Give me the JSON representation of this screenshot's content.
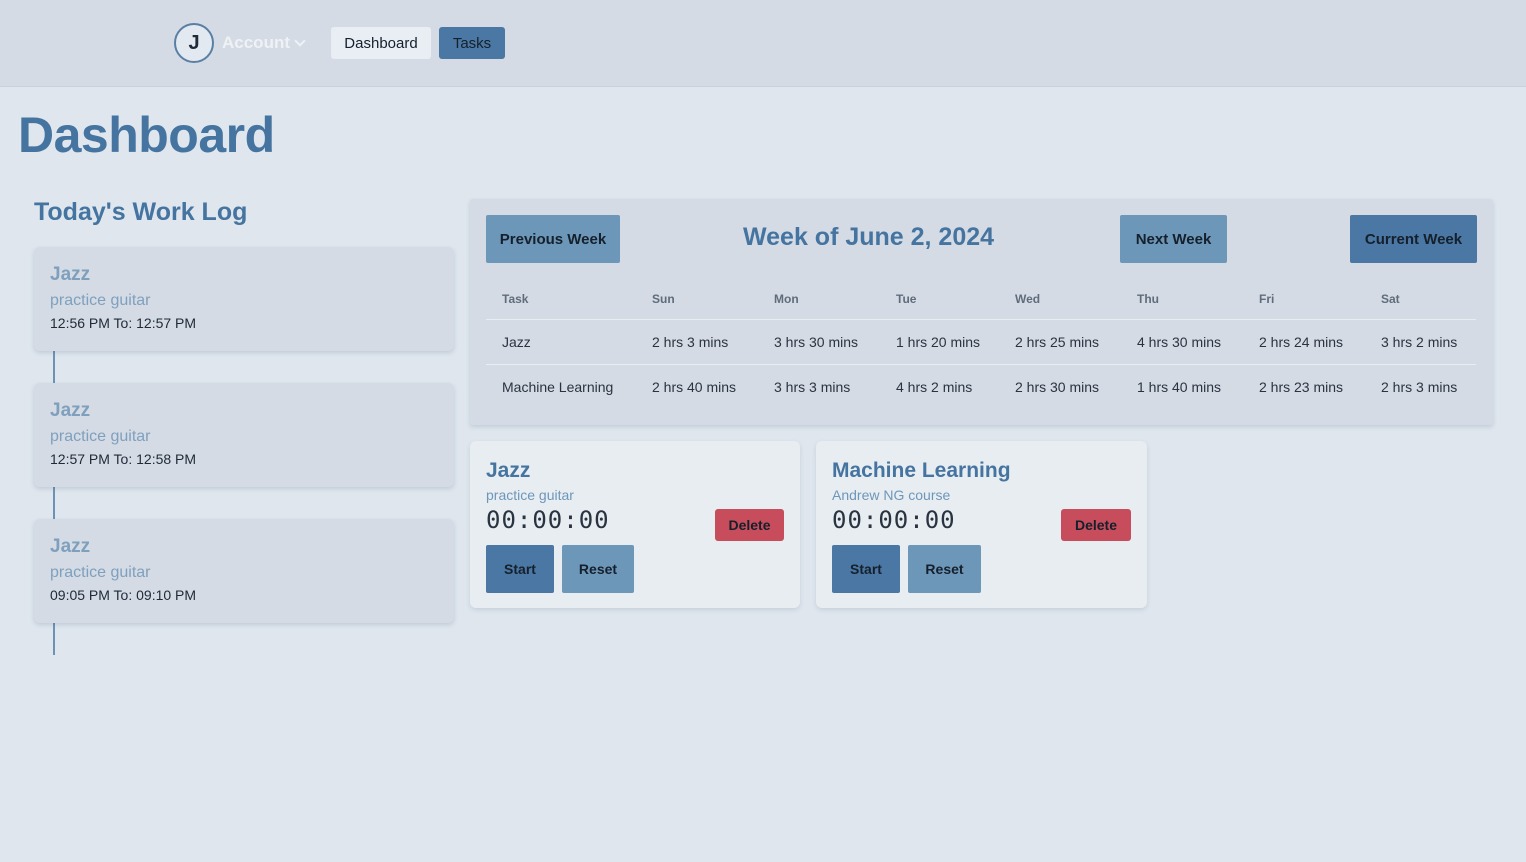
{
  "header": {
    "avatar_initial": "J",
    "account_label": "Account",
    "nav": {
      "dashboard": "Dashboard",
      "tasks": "Tasks"
    }
  },
  "page": {
    "title": "Dashboard"
  },
  "worklog": {
    "title": "Today's Work Log",
    "entries": [
      {
        "task": "Jazz",
        "desc": "practice guitar",
        "time": "12:56 PM To: 12:57 PM"
      },
      {
        "task": "Jazz",
        "desc": "practice guitar",
        "time": "12:57 PM To: 12:58 PM"
      },
      {
        "task": "Jazz",
        "desc": "practice guitar",
        "time": "09:05 PM To: 09:10 PM"
      }
    ]
  },
  "week": {
    "prev_label": "Previous Week",
    "title": "Week of June 2, 2024",
    "next_label": "Next Week",
    "current_label": "Current Week",
    "columns": [
      "Task",
      "Sun",
      "Mon",
      "Tue",
      "Wed",
      "Thu",
      "Fri",
      "Sat"
    ],
    "rows": [
      [
        "Jazz",
        "2 hrs 3 mins",
        "3 hrs 30 mins",
        "1 hrs 20 mins",
        "2 hrs 25 mins",
        "4 hrs 30 mins",
        "2 hrs 24 mins",
        "3 hrs 2 mins"
      ],
      [
        "Machine Learning",
        "2 hrs 40 mins",
        "3 hrs 3 mins",
        "4 hrs 2 mins",
        "2 hrs 30 mins",
        "1 hrs 40 mins",
        "2 hrs 23 mins",
        "2 hrs 3 mins"
      ]
    ]
  },
  "tasks": [
    {
      "name": "Jazz",
      "desc": "practice guitar",
      "timer": "00:00:00",
      "delete": "Delete",
      "start": "Start",
      "reset": "Reset"
    },
    {
      "name": "Machine Learning",
      "desc": "Andrew NG course",
      "timer": "00:00:00",
      "delete": "Delete",
      "start": "Start",
      "reset": "Reset"
    }
  ]
}
